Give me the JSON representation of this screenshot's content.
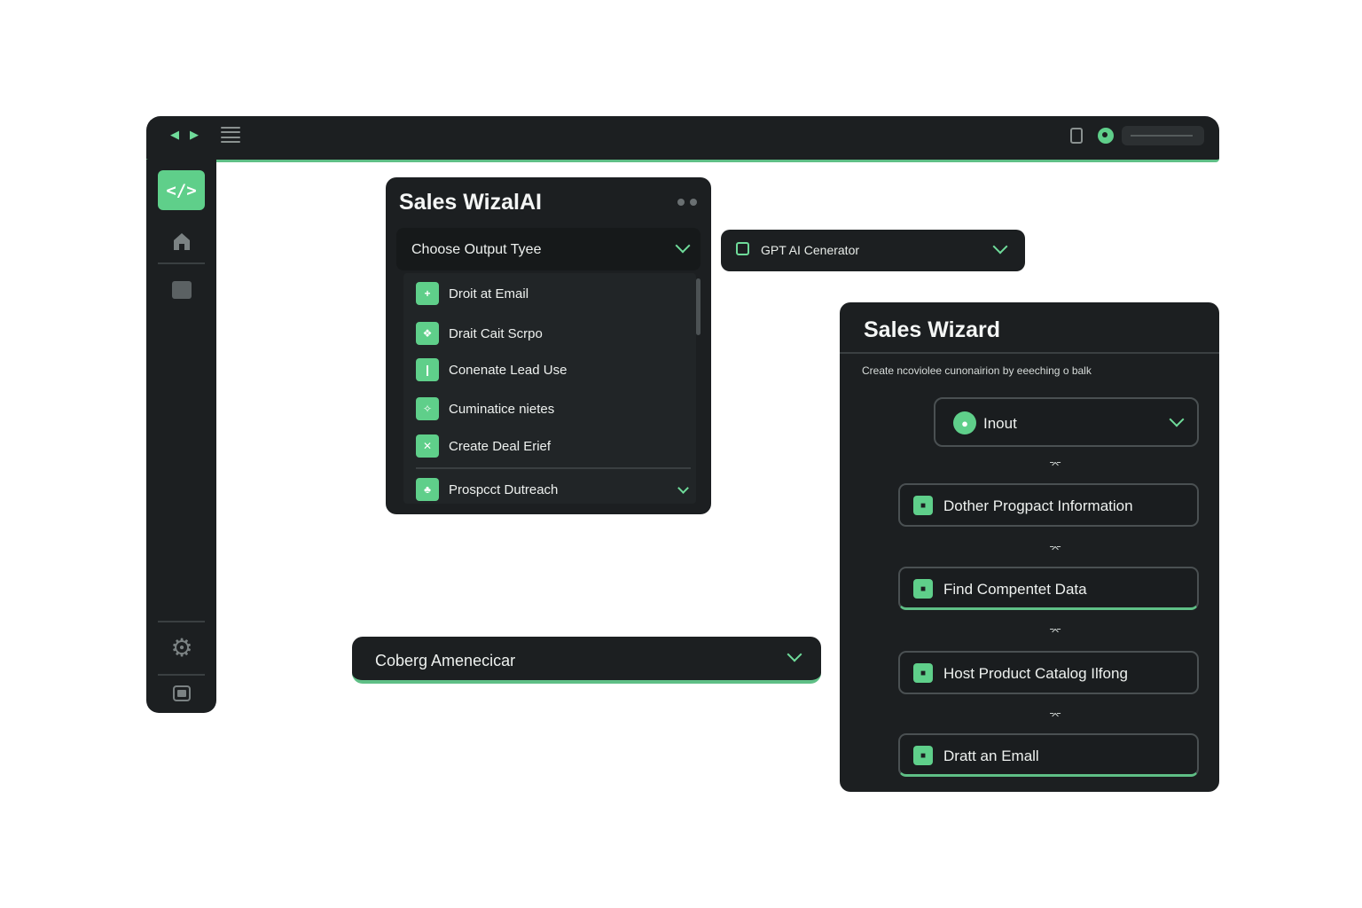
{
  "topbar": {
    "icons": [
      "chevron-left-icon",
      "chevron-right-icon",
      "menu-icon",
      "phone-icon",
      "status-icon",
      "search-bar"
    ],
    "accent_color": "#5fbf86"
  },
  "sidebar": {
    "items": [
      {
        "icon": "code-icon",
        "active": true
      },
      {
        "icon": "home-icon"
      },
      {
        "icon": "square-icon"
      },
      {
        "icon": "gear-icon"
      },
      {
        "icon": "screen-icon"
      }
    ]
  },
  "panel_wizal": {
    "title": "Sales WizalAI",
    "select_label": "Choose Output Tyee",
    "items": [
      {
        "label": "Droit at Email",
        "icon": "+"
      },
      {
        "label": "Drait Cait Scrpo",
        "icon": "❖"
      },
      {
        "label": "Conenate Lead Use",
        "icon": "❙"
      },
      {
        "label": "Cuminatice nietes",
        "icon": "✧"
      },
      {
        "label": "Create Deal Erief",
        "icon": "✕"
      },
      {
        "label": "Prospcct Dutreach",
        "icon": "♣"
      }
    ]
  },
  "panel_gpt": {
    "label": "GPT AI Cenerator"
  },
  "panel_company": {
    "label": "Coberg Amenecicar"
  },
  "panel_wizard": {
    "title": "Sales Wizard",
    "subtitle": "Create ncoviolee cunonairion by eeeching o balk",
    "input_label": "Inout",
    "steps": [
      {
        "label": "Dother Progpact Information",
        "accent": false
      },
      {
        "label": "Find Compentet Data",
        "accent": true
      },
      {
        "label": "Host Product Catalog Ilfong",
        "accent": false
      },
      {
        "label": "Dratt an Emall",
        "accent": true
      }
    ]
  },
  "colors": {
    "background": "#ffffff",
    "panel": "#1c1f21",
    "accent": "#5fcf8a",
    "text": "#eef1ef"
  }
}
